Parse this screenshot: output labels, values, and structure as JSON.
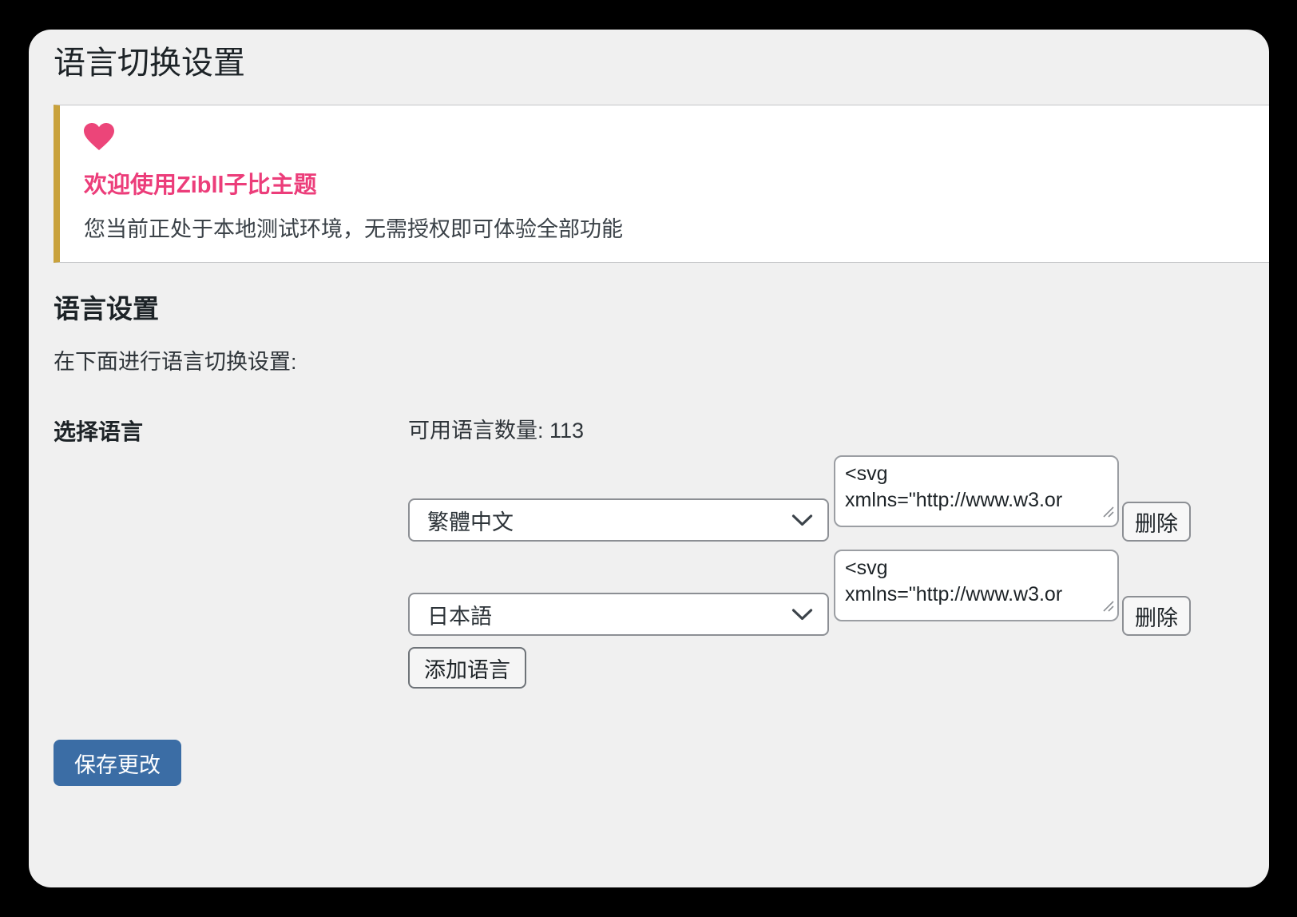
{
  "page": {
    "title": "语言切换设置"
  },
  "notice": {
    "icon": "heart-icon",
    "heading": "欢迎使用Zibll子比主题",
    "description": "您当前正处于本地测试环境，无需授权即可体验全部功能"
  },
  "section": {
    "heading": "语言设置",
    "intro": "在下面进行语言切换设置:"
  },
  "form": {
    "label": "选择语言",
    "available_count": "可用语言数量: 113",
    "languages": [
      {
        "selected": "繁體中文",
        "icon_code": "<svg xmlns=\"http://www.w3.or",
        "delete_label": "删除"
      },
      {
        "selected": "日本語",
        "icon_code": "<svg xmlns=\"http://www.w3.or",
        "delete_label": "删除"
      }
    ],
    "add_button": "添加语言"
  },
  "actions": {
    "save_button": "保存更改"
  },
  "colors": {
    "background": "#000000",
    "card_bg": "#f0f0f0",
    "notice_left_border": "#c9a23c",
    "accent_pink": "#ec3d7a",
    "save_blue": "#3b6da5"
  }
}
